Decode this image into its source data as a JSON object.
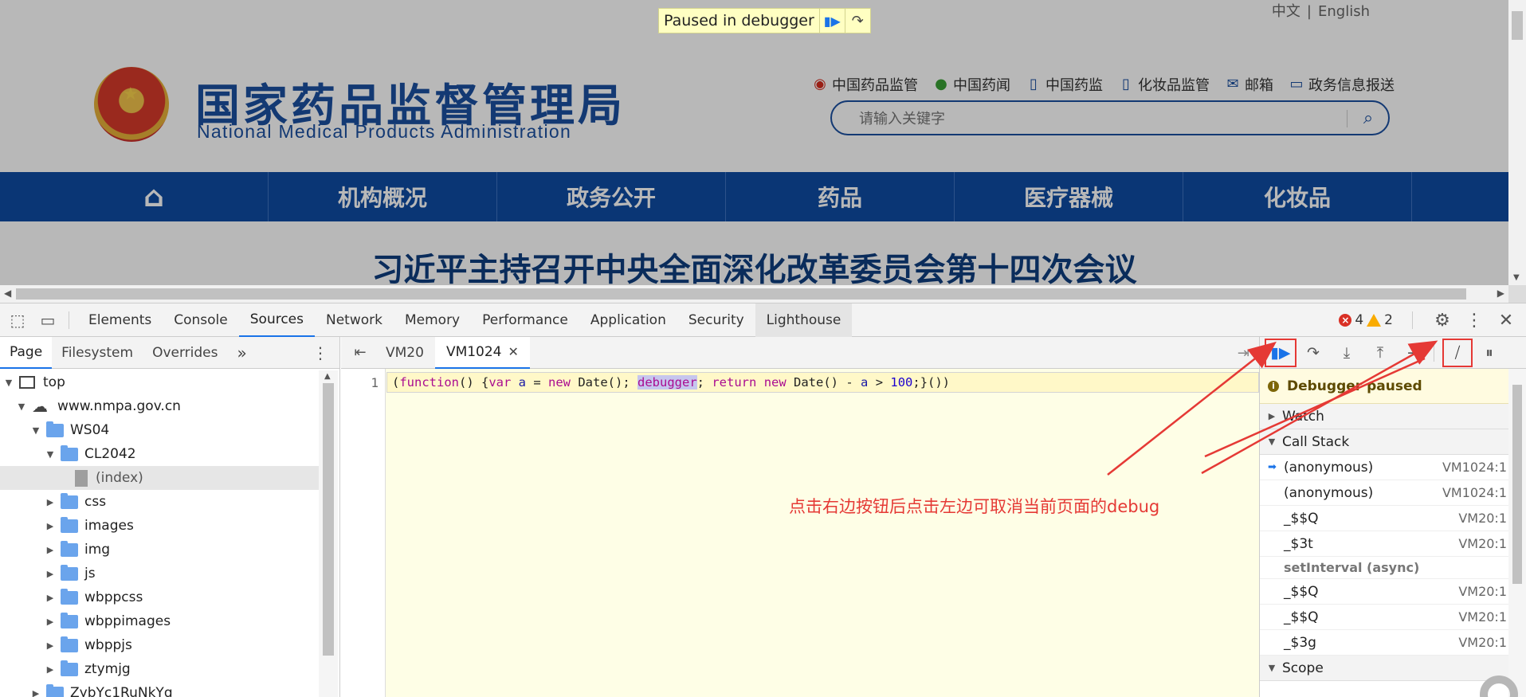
{
  "site": {
    "lang_cn": "中文",
    "lang_sep": "|",
    "lang_en": "English",
    "logo_cn": "国家药品监督管理局",
    "logo_en": "National Medical Products Administration",
    "quick_links": [
      "中国药品监管",
      "中国药闻",
      "中国药监",
      "化妆品监管",
      "邮箱",
      "政务信息报送"
    ],
    "search_placeholder": "请输入关键字",
    "nav": [
      "机构概况",
      "政务公开",
      "药品",
      "医疗器械",
      "化妆品"
    ],
    "headline": "习近平主持召开中央全面深化改革委员会第十四次会议"
  },
  "banner": {
    "text": "Paused in debugger"
  },
  "devtools": {
    "tabs": [
      "Elements",
      "Console",
      "Sources",
      "Network",
      "Memory",
      "Performance",
      "Application",
      "Security",
      "Lighthouse"
    ],
    "active_tab": "Sources",
    "errors": "4",
    "warnings": "2",
    "navigator": {
      "tabs": [
        "Page",
        "Filesystem",
        "Overrides"
      ],
      "more": "»",
      "tree": {
        "top": "top",
        "domain": "www.nmpa.gov.cn",
        "ws04": "WS04",
        "cl2042": "CL2042",
        "index": "(index)",
        "folders": [
          "css",
          "images",
          "img",
          "js",
          "wbppcss",
          "wbppimages",
          "wbppjs",
          "ztymjg"
        ],
        "last": "ZybYc1RuNkYg"
      }
    },
    "editor": {
      "tabs": [
        "VM20",
        "VM1024"
      ],
      "line_number": "1",
      "code": {
        "t1": "(",
        "t2": "function",
        "t3": "() {",
        "t4": "var",
        "t5": " ",
        "t6": "a",
        "t7": " = ",
        "t8": "new",
        "t9": " Date(); ",
        "t10": "debugger",
        "t11": "; ",
        "t12": "return",
        "t13": " ",
        "t14": "new",
        "t15": " Date() - ",
        "t16": "a",
        "t17": " > ",
        "t18": "100",
        "t19": ";}())"
      }
    },
    "debugger": {
      "paused_message": "Debugger paused",
      "watch": "Watch",
      "call_stack": "Call Stack",
      "frames_top": [
        {
          "name": "(anonymous)",
          "loc": "VM1024:1"
        },
        {
          "name": "(anonymous)",
          "loc": "VM1024:1"
        },
        {
          "name": "_$$Q",
          "loc": "VM20:1"
        },
        {
          "name": "_$3t",
          "loc": "VM20:1"
        }
      ],
      "async_label": "setInterval (async)",
      "frames_bottom": [
        {
          "name": "_$$Q",
          "loc": "VM20:1"
        },
        {
          "name": "_$$Q",
          "loc": "VM20:1"
        },
        {
          "name": "_$3g",
          "loc": "VM20:1"
        }
      ],
      "scope": "Scope"
    }
  },
  "annotation": "点击右边按钮后点击左边可取消当前页面的debug",
  "colors": {
    "accent": "#1a73e8",
    "annotation": "#e53935",
    "nav_blue": "#0e4ba3"
  }
}
